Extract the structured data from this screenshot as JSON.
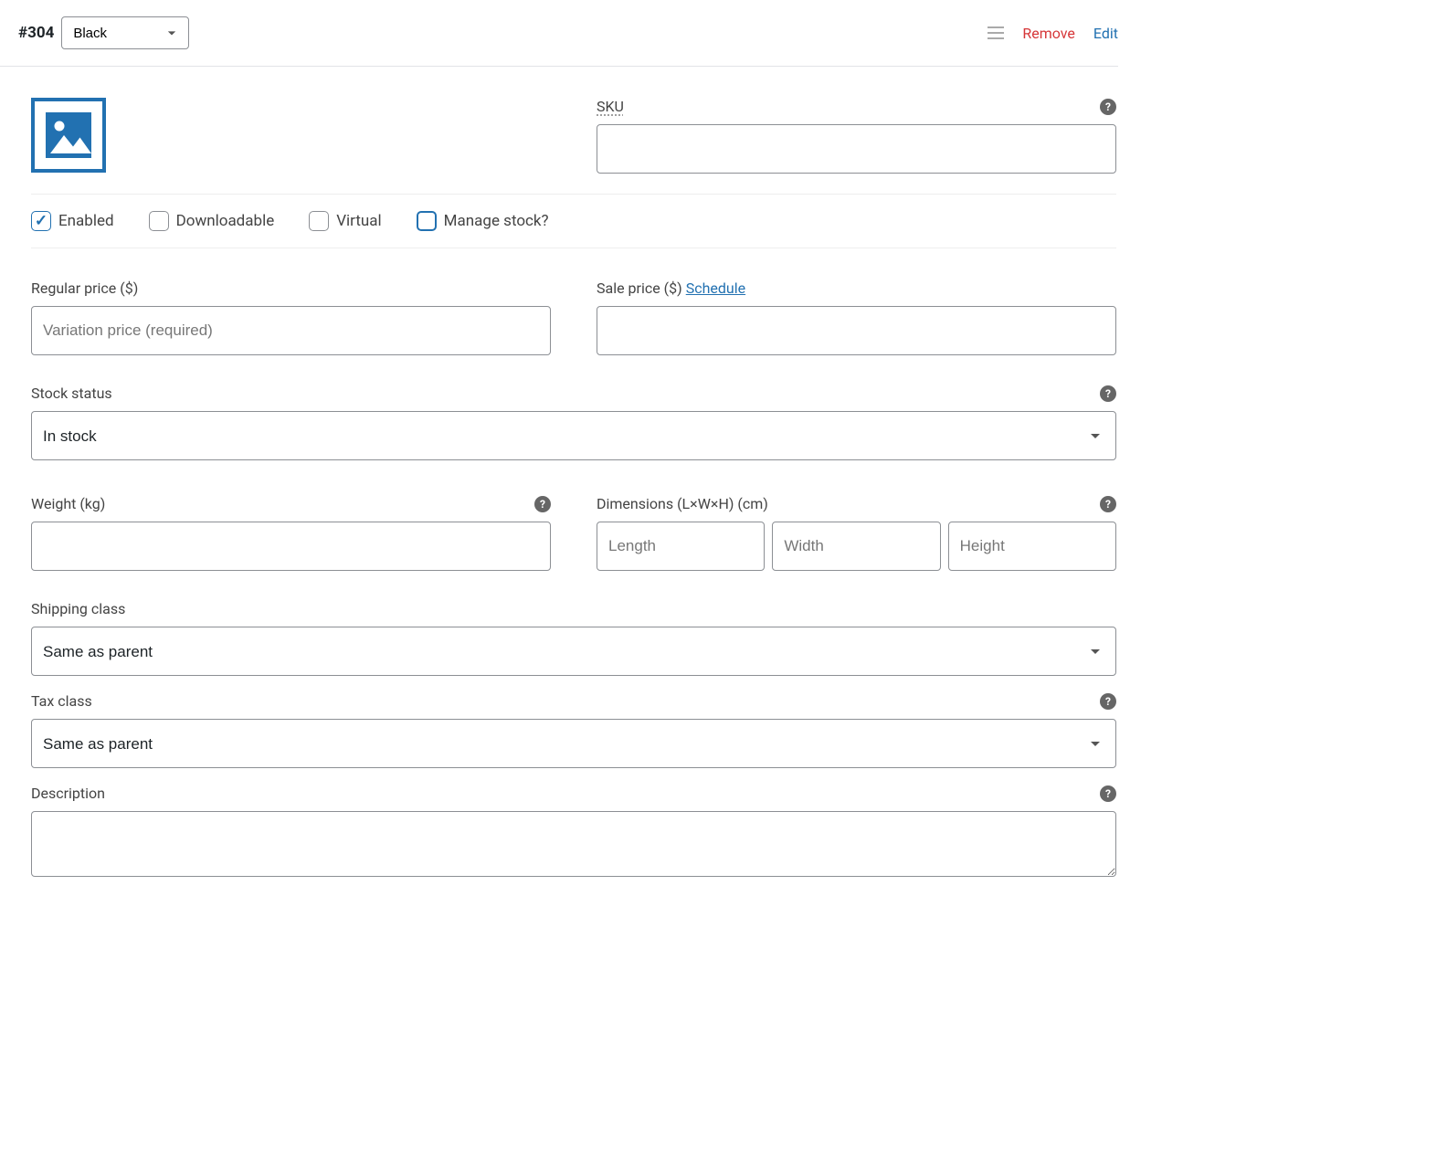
{
  "header": {
    "variation_id": "#304",
    "attribute_selected": "Black",
    "remove_label": "Remove",
    "edit_label": "Edit"
  },
  "image": {
    "icon_name": "image-placeholder-icon"
  },
  "sku": {
    "label": "SKU",
    "value": ""
  },
  "checkboxes": {
    "enabled": {
      "label": "Enabled",
      "checked": true
    },
    "downloadable": {
      "label": "Downloadable",
      "checked": false
    },
    "virtual": {
      "label": "Virtual",
      "checked": false
    },
    "manage_stock": {
      "label": "Manage stock?",
      "checked": false,
      "focused": true
    }
  },
  "prices": {
    "regular_label": "Regular price ($)",
    "regular_placeholder": "Variation price (required)",
    "regular_value": "",
    "sale_label": "Sale price ($)",
    "schedule_label": "Schedule",
    "sale_value": ""
  },
  "stock_status": {
    "label": "Stock status",
    "selected": "In stock"
  },
  "weight": {
    "label": "Weight (kg)",
    "value": ""
  },
  "dimensions": {
    "label": "Dimensions (L×W×H) (cm)",
    "length_placeholder": "Length",
    "width_placeholder": "Width",
    "height_placeholder": "Height",
    "length_value": "",
    "width_value": "",
    "height_value": ""
  },
  "shipping_class": {
    "label": "Shipping class",
    "selected": "Same as parent"
  },
  "tax_class": {
    "label": "Tax class",
    "selected": "Same as parent"
  },
  "description": {
    "label": "Description",
    "value": ""
  }
}
